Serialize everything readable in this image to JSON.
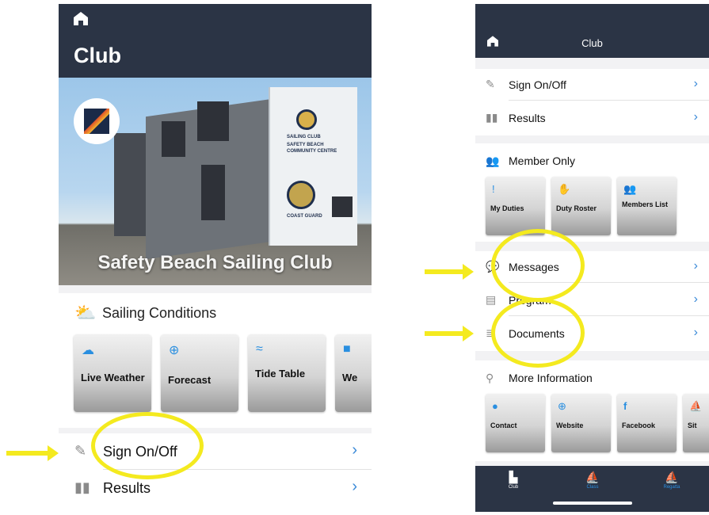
{
  "left": {
    "title": "Club",
    "hero_caption": "Safety Beach Sailing Club",
    "building_signs": [
      "SAILING CLUB",
      "SAFETY BEACH",
      "COMMUNITY CENTRE",
      "COAST GUARD"
    ],
    "conditions_title": "Sailing Conditions",
    "tiles": [
      {
        "label": "Live Weather",
        "icon": "cloud-sun-icon"
      },
      {
        "label": "Forecast",
        "icon": "magnifier-icon"
      },
      {
        "label": "Tide Table",
        "icon": "wave-icon"
      },
      {
        "label": "We",
        "icon": "square-icon"
      }
    ],
    "rows": [
      {
        "label": "Sign On/Off",
        "icon": "pen-icon"
      },
      {
        "label": "Results",
        "icon": "book-icon"
      }
    ]
  },
  "right": {
    "title": "Club",
    "rows_top": [
      {
        "label": "Sign On/Off",
        "icon": "pen-icon"
      },
      {
        "label": "Results",
        "icon": "book-icon"
      }
    ],
    "member_title": "Member Only",
    "member_tiles": [
      {
        "label": "My Duties",
        "icon": "exclamation-icon"
      },
      {
        "label": "Duty Roster",
        "icon": "handshake-icon"
      },
      {
        "label": "Members List",
        "icon": "people-icon"
      }
    ],
    "rows_mid": [
      {
        "label": "Messages",
        "icon": "chat-icon"
      },
      {
        "label": "Program",
        "icon": "doc-icon"
      },
      {
        "label": "Documents",
        "icon": "stack-icon"
      }
    ],
    "info_title": "More Information",
    "info_tiles": [
      {
        "label": "Contact",
        "icon": "pin-icon"
      },
      {
        "label": "Website",
        "icon": "globe-icon"
      },
      {
        "label": "Facebook",
        "icon": "facebook-icon"
      },
      {
        "label": "Sit",
        "icon": "boat-icon"
      }
    ],
    "tabs": [
      {
        "label": "Club",
        "icon": "clubhouse-icon"
      },
      {
        "label": "Class",
        "icon": "sail-icon"
      },
      {
        "label": "Regatta",
        "icon": "sail-icon"
      }
    ]
  },
  "colors": {
    "header": "#2b3445",
    "accent": "#2a8fe0",
    "highlight": "#f4ea1f"
  }
}
